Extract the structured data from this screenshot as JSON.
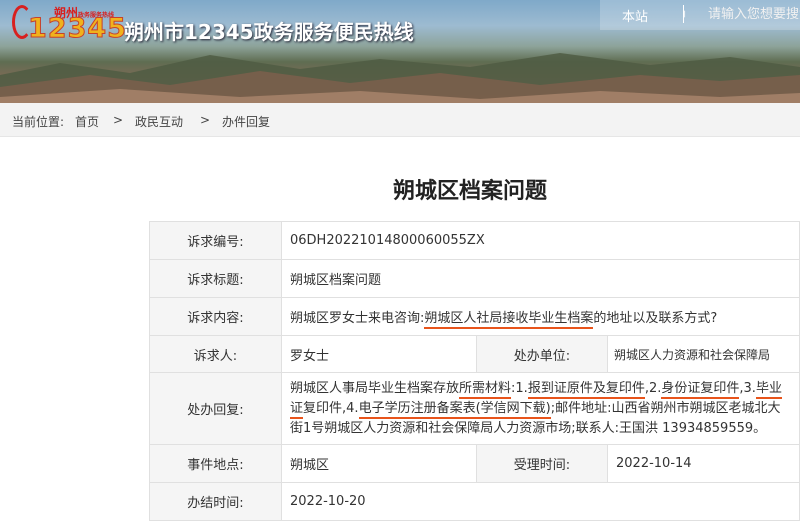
{
  "header": {
    "logo_brand": "朔州",
    "logo_tagline": "政务服务热线",
    "logo_number": "12345",
    "site_title": "朔州市12345政务服务便民热线",
    "search_scope": "本站",
    "search_placeholder": "请输入您想要搜索的内容"
  },
  "breadcrumb": {
    "prefix": "当前位置:",
    "items": [
      "首页",
      "政民互动",
      "办件回复"
    ],
    "separator": ">"
  },
  "article": {
    "title": "朔城区档案问题"
  },
  "detail": {
    "request_no_label": "诉求编号:",
    "request_no": "06DH20221014800060055ZX",
    "subject_label": "诉求标题:",
    "subject": "朔城区档案问题",
    "content_label": "诉求内容:",
    "content_prefix": "朔城区罗女士来电咨询:",
    "content_highlight": "朔城区人社局接收毕业生档案",
    "content_suffix": "的地址以及联系方式?",
    "petitioner_label": "诉求人:",
    "petitioner": "罗女士",
    "handler_label": "处办单位:",
    "handler": "朔城区人力资源和社会保障局",
    "reply_label": "处办回复:",
    "reply_parts": [
      "朔城区人事局毕业生档案存放",
      "所需材料",
      ":1.",
      "报到证原件及复印件",
      ",2.",
      "身份证复印件",
      ",3.",
      "毕业证",
      "复印件,4.",
      "电子学历注册备案表(学信网下载)",
      ";邮件地址:山西省朔州市朔城区老城北大街1号朔城区人力资源和社会保障局人力资源市场;联系人:王国洪 13934859559。"
    ],
    "location_label": "事件地点:",
    "location": "朔城区",
    "accept_time_label": "受理时间:",
    "accept_time": "2022-10-14",
    "finish_time_label": "办结时间:",
    "finish_time": "2022-10-20"
  },
  "colors": {
    "accent_underline": "#e8541b",
    "label_bg": "#f5f5f5",
    "border": "#e0e0e0"
  }
}
